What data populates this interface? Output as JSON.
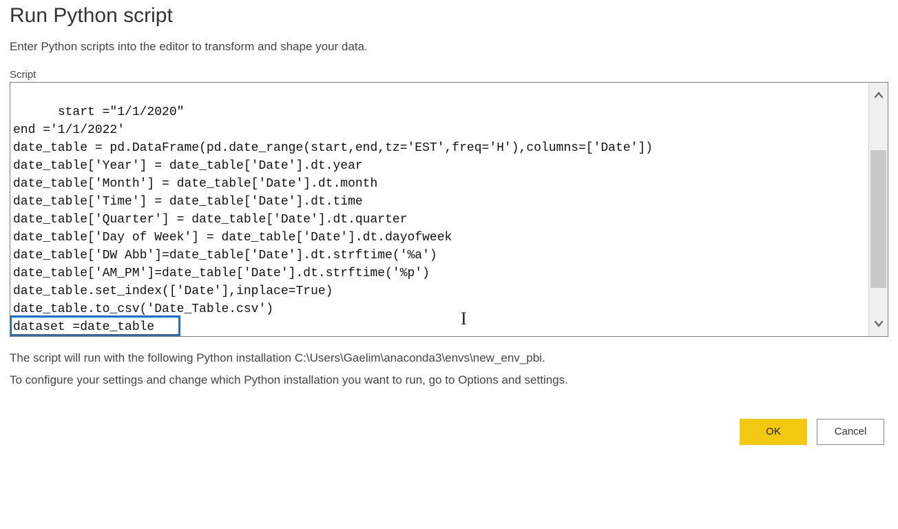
{
  "dialog": {
    "title": "Run Python script",
    "subtitle": "Enter Python scripts into the editor to transform and shape your data.",
    "script_label": "Script",
    "script_text": "start =\"1/1/2020\"\nend ='1/1/2022'\ndate_table = pd.DataFrame(pd.date_range(start,end,tz='EST',freq='H'),columns=['Date'])\ndate_table['Year'] = date_table['Date'].dt.year\ndate_table['Month'] = date_table['Date'].dt.month\ndate_table['Time'] = date_table['Date'].dt.time\ndate_table['Quarter'] = date_table['Date'].dt.quarter\ndate_table['Day of Week'] = date_table['Date'].dt.dayofweek\ndate_table['DW Abb']=date_table['Date'].dt.strftime('%a')\ndate_table['AM_PM']=date_table['Date'].dt.strftime('%p')\ndate_table.set_index(['Date'],inplace=True)\ndate_table.to_csv('Date_Table.csv')\ndataset =date_table",
    "info1": "The script will run with the following Python installation C:\\Users\\Gaelim\\anaconda3\\envs\\new_env_pbi.",
    "info2": "To configure your settings and change which Python installation you want to run, go to Options and settings.",
    "ok_label": "OK",
    "cancel_label": "Cancel"
  }
}
